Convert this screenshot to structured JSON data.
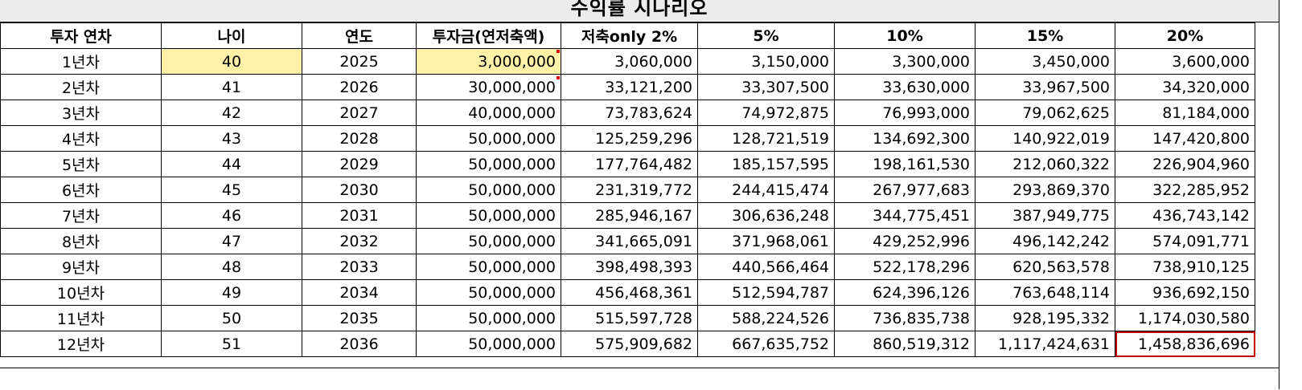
{
  "sheet": {
    "title": "수익률 시나리오"
  },
  "table": {
    "headers": [
      "투자 연차",
      "나이",
      "연도",
      "투자금(연저축액)",
      "저축only 2%",
      "5%",
      "10%",
      "15%",
      "20%"
    ],
    "rows": [
      [
        "1년차",
        "40",
        "2025",
        "3,000,000",
        "3,060,000",
        "3,150,000",
        "3,300,000",
        "3,450,000",
        "3,600,000"
      ],
      [
        "2년차",
        "41",
        "2026",
        "30,000,000",
        "33,121,200",
        "33,307,500",
        "33,630,000",
        "33,967,500",
        "34,320,000"
      ],
      [
        "3년차",
        "42",
        "2027",
        "40,000,000",
        "73,783,624",
        "74,972,875",
        "76,993,000",
        "79,062,625",
        "81,184,000"
      ],
      [
        "4년차",
        "43",
        "2028",
        "50,000,000",
        "125,259,296",
        "128,721,519",
        "134,692,300",
        "140,922,019",
        "147,420,800"
      ],
      [
        "5년차",
        "44",
        "2029",
        "50,000,000",
        "177,764,482",
        "185,157,595",
        "198,161,530",
        "212,060,322",
        "226,904,960"
      ],
      [
        "6년차",
        "45",
        "2030",
        "50,000,000",
        "231,319,772",
        "244,415,474",
        "267,977,683",
        "293,869,370",
        "322,285,952"
      ],
      [
        "7년차",
        "46",
        "2031",
        "50,000,000",
        "285,946,167",
        "306,636,248",
        "344,775,451",
        "387,949,775",
        "436,743,142"
      ],
      [
        "8년차",
        "47",
        "2032",
        "50,000,000",
        "341,665,091",
        "371,968,061",
        "429,252,996",
        "496,142,242",
        "574,091,771"
      ],
      [
        "9년차",
        "48",
        "2033",
        "50,000,000",
        "398,498,393",
        "440,566,464",
        "522,178,296",
        "620,563,578",
        "738,910,125"
      ],
      [
        "10년차",
        "49",
        "2034",
        "50,000,000",
        "456,468,361",
        "512,594,787",
        "624,396,126",
        "763,648,114",
        "936,692,150"
      ],
      [
        "11년차",
        "50",
        "2035",
        "50,000,000",
        "515,597,728",
        "588,224,526",
        "736,835,738",
        "928,195,332",
        "1,174,030,580"
      ],
      [
        "12년차",
        "51",
        "2036",
        "50,000,000",
        "575,909,682",
        "667,635,752",
        "860,519,312",
        "1,117,424,631",
        "1,458,836,696"
      ]
    ]
  },
  "colors": {
    "highlight": "#fff2a8",
    "selection": "#c00000",
    "comment_marker": "#e00000",
    "title_bg": "#ececec"
  }
}
